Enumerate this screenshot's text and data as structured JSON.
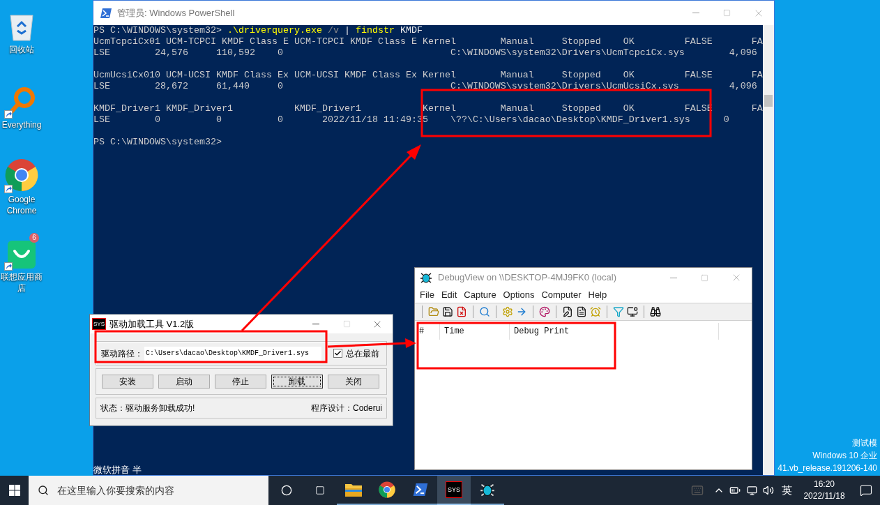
{
  "desktop_icons": [
    {
      "label": "回收站",
      "kind": "recycle_bin",
      "shortcut": false
    },
    {
      "label": "Everything",
      "kind": "everything",
      "shortcut": true
    },
    {
      "label": "Google Chrome",
      "kind": "chrome",
      "shortcut": true
    },
    {
      "label": "联想应用商店",
      "kind": "store",
      "shortcut": true,
      "badge": "6"
    }
  ],
  "powershell": {
    "title": "管理员: Windows PowerShell",
    "command": {
      "prompt": "PS C:\\WINDOWS\\system32> ",
      "tokens": [
        {
          "text": ".\\driverquery.exe",
          "kind": "command"
        },
        {
          "text": " /v",
          "kind": "parameter"
        },
        {
          "text": " | ",
          "kind": "operator"
        },
        {
          "text": "findstr",
          "kind": "command"
        },
        {
          "text": " KMDF",
          "kind": "argument"
        }
      ]
    },
    "output": [
      [
        "UcmTcpciCx01 UCM-TCPCI KMDF Class E UCM-TCPCI KMDF Class E Kernel        Manual     Stopped    OK         FALSE       FA",
        "LSE        24,576     110,592    0                              C:\\WINDOWS\\system32\\Drivers\\UcmTcpciCx.sys        4,096"
      ],
      [
        "UcmUcsiCx010 UCM-UCSI KMDF Class Ex UCM-UCSI KMDF Class Ex Kernel        Manual     Stopped    OK         FALSE       FA",
        "LSE        28,672     61,440     0                              C:\\WINDOWS\\system32\\Drivers\\UcmUcsiCx.sys         4,096"
      ],
      [
        "KMDF_Driver1 KMDF_Driver1           KMDF_Driver1           Kernel        Manual     Stopped    OK         FALSE       FA",
        "LSE        0          0          0       2022/11/18 11:49:35    \\??\\C:\\Users\\dacao\\Desktop\\KMDF_Driver1.sys      0"
      ]
    ],
    "final_prompt": "PS C:\\WINDOWS\\system32>"
  },
  "ime_bar": "微软拼音 半",
  "test_mode": [
    "测试模",
    "Windows 10 企业",
    "41.vb_release.191206-140"
  ],
  "driver_tool": {
    "icon_text": "SYS",
    "title": "驱动加载工具 V1.2版",
    "path_label": "驱动路径：",
    "path_value": "C:\\Users\\dacao\\Desktop\\KMDF_Driver1.sys",
    "topmost": {
      "label": "总在最前",
      "checked": true
    },
    "buttons": [
      {
        "label": "安装",
        "focused": false
      },
      {
        "label": "启动",
        "focused": false
      },
      {
        "label": "停止",
        "focused": false
      },
      {
        "label": "卸载",
        "focused": true
      },
      {
        "label": "关闭",
        "focused": false
      }
    ],
    "status": "状态：驱动服务卸载成功!",
    "credit": "程序设计：Coderui"
  },
  "debugview": {
    "title": "DebugView on \\\\DESKTOP-4MJ9FK0 (local)",
    "menus": [
      "File",
      "Edit",
      "Capture",
      "Options",
      "Computer",
      "Help"
    ],
    "columns": [
      "#",
      "Time",
      "Debug Print"
    ]
  },
  "taskbar": {
    "search_placeholder": "在这里输入你要搜索的内容",
    "apps": [
      {
        "kind": "explorer",
        "selected": false
      },
      {
        "kind": "chrome",
        "selected": false
      },
      {
        "kind": "powershell",
        "selected": false
      },
      {
        "kind": "sys",
        "label": "SYS",
        "selected": true
      },
      {
        "kind": "debugview",
        "selected": false
      }
    ],
    "input_language": "英",
    "time": "16:20",
    "date": "2022/11/18"
  }
}
